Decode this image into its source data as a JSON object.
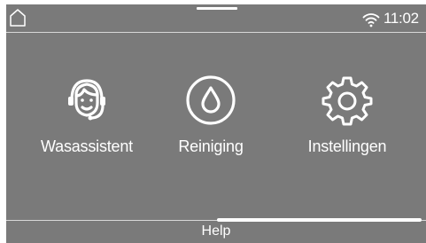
{
  "status_bar": {
    "time": "11:02",
    "home_icon": "home-icon",
    "wifi_icon": "wifi-icon"
  },
  "tiles": [
    {
      "label": "Wasassistent",
      "icon": "headset-assistant-icon"
    },
    {
      "label": "Reiniging",
      "icon": "water-drop-icon"
    },
    {
      "label": "Instellingen",
      "icon": "gear-icon"
    }
  ],
  "footer": {
    "help_label": "Help"
  },
  "colors": {
    "background": "#7a7a7a",
    "foreground": "#ffffff",
    "divider": "#d8d8d8"
  }
}
